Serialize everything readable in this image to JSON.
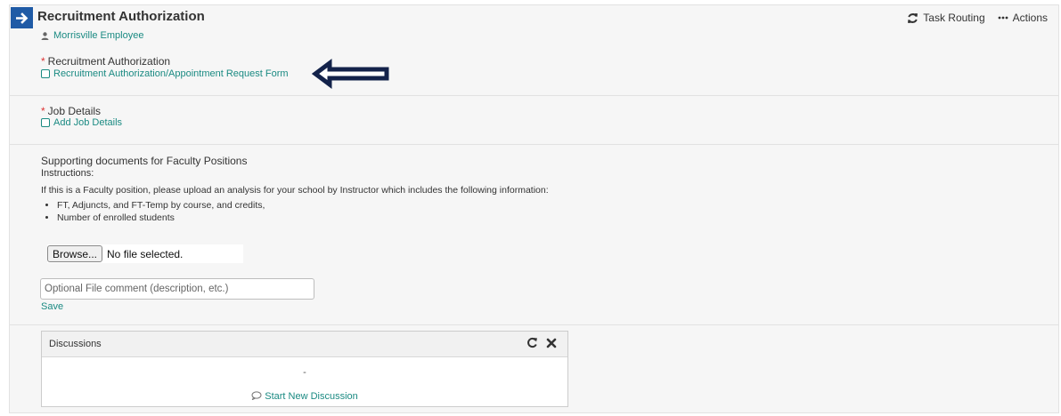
{
  "header": {
    "title": "Recruitment Authorization",
    "owner": "Morrisville Employee",
    "task_routing": "Task Routing",
    "actions": "Actions"
  },
  "sections": {
    "recruitment": {
      "required": "*",
      "label": "Recruitment Authorization",
      "link": "Recruitment Authorization/Appointment Request Form"
    },
    "job": {
      "required": "*",
      "label": "Job Details",
      "link": "Add Job Details"
    },
    "supporting": {
      "label": "Supporting documents for Faculty Positions",
      "instructions_label": "Instructions:",
      "instructions_text": "If this is a Faculty position, please upload an analysis for your school by Instructor  which includes the following information:",
      "bullets": [
        "FT, Adjuncts, and FT-Temp by course, and credits,",
        "Number of enrolled students"
      ],
      "browse_label": "Browse...",
      "no_file": "No file selected.",
      "comment_placeholder": "Optional File comment (description, etc.)",
      "save_label": "Save"
    }
  },
  "discussions": {
    "title": "Discussions",
    "empty_marker": "-",
    "start_label": "Start New Discussion"
  },
  "colors": {
    "accent_blue": "#1f5ba6",
    "link_teal": "#1a8a82",
    "required_red": "#dd3333",
    "arrow_navy": "#13224a"
  },
  "icons": {
    "go": "arrow-right-icon",
    "owner": "user-icon",
    "refresh": "refresh-icon",
    "more": "ellipsis-icon",
    "close": "close-icon",
    "chat": "comment-icon"
  }
}
